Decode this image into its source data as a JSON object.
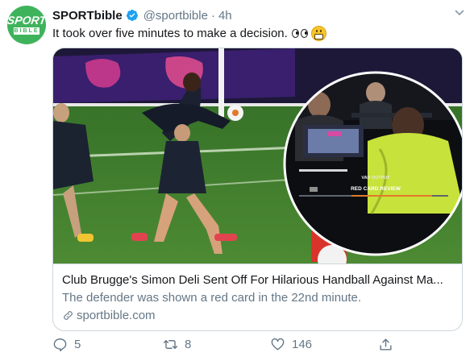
{
  "tweet": {
    "avatar_text": "SPORT",
    "avatar_sub": "BIBLE",
    "display_name": "SPORTbible",
    "handle": "@sportbible",
    "separator": "·",
    "time": "4h",
    "text": "It took over five minutes to make a decision."
  },
  "card": {
    "image_caption_small": "VAR OUTPUT",
    "image_caption_main": "RED CARD REVIEW",
    "title": "Club Brugge's Simon Deli Sent Off For Hilarious Handball Against Ma...",
    "description": "The defender was shown a red card in the 22nd minute.",
    "domain": "sportbible.com"
  },
  "actions": {
    "reply_count": "5",
    "retweet_count": "8",
    "like_count": "146"
  },
  "colors": {
    "brand_green": "#3fb35c",
    "verified_blue": "#1da1f2",
    "muted": "#657786"
  }
}
